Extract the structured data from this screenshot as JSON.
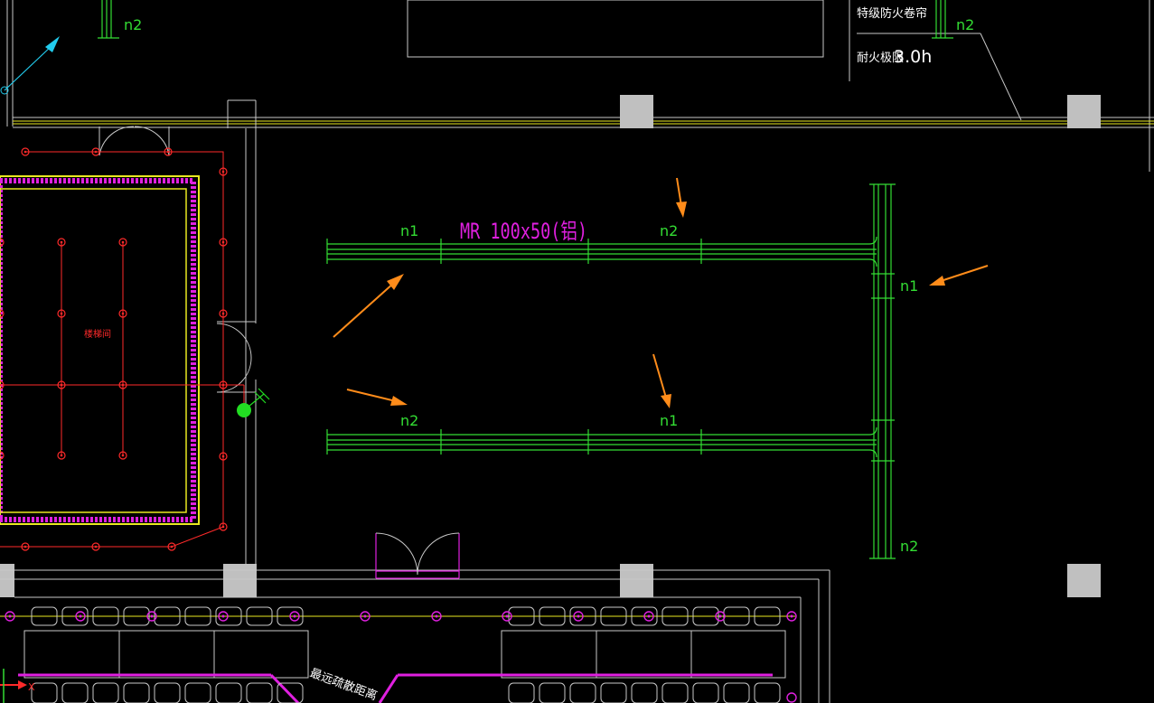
{
  "colors": {
    "background": "#000000",
    "wall": "#c8c8c8",
    "tray": "#33dd33",
    "annotation_arrow": "#ff8c1a",
    "light_fixture": "#ff2a2a",
    "magenta": "#e020e0",
    "yellow": "#e8e820",
    "column": "#c0c0c0"
  },
  "labels": {
    "tray_spec": "MR 100x50(铝)",
    "fire_shutter": "特级防火卷帘",
    "fire_rating_prefix": "耐火极限",
    "fire_rating_value": "3.0h",
    "room_name": "楼梯间",
    "n1": "n1",
    "n2": "n2",
    "distance_note": "最远疏散距离",
    "axis_x": "X"
  },
  "arrows": [
    {
      "target": "tray-top-left"
    },
    {
      "target": "label-n2-top"
    },
    {
      "target": "label-n1-right"
    },
    {
      "target": "label-n2-bottom-left"
    },
    {
      "target": "label-n1-bottom"
    }
  ]
}
